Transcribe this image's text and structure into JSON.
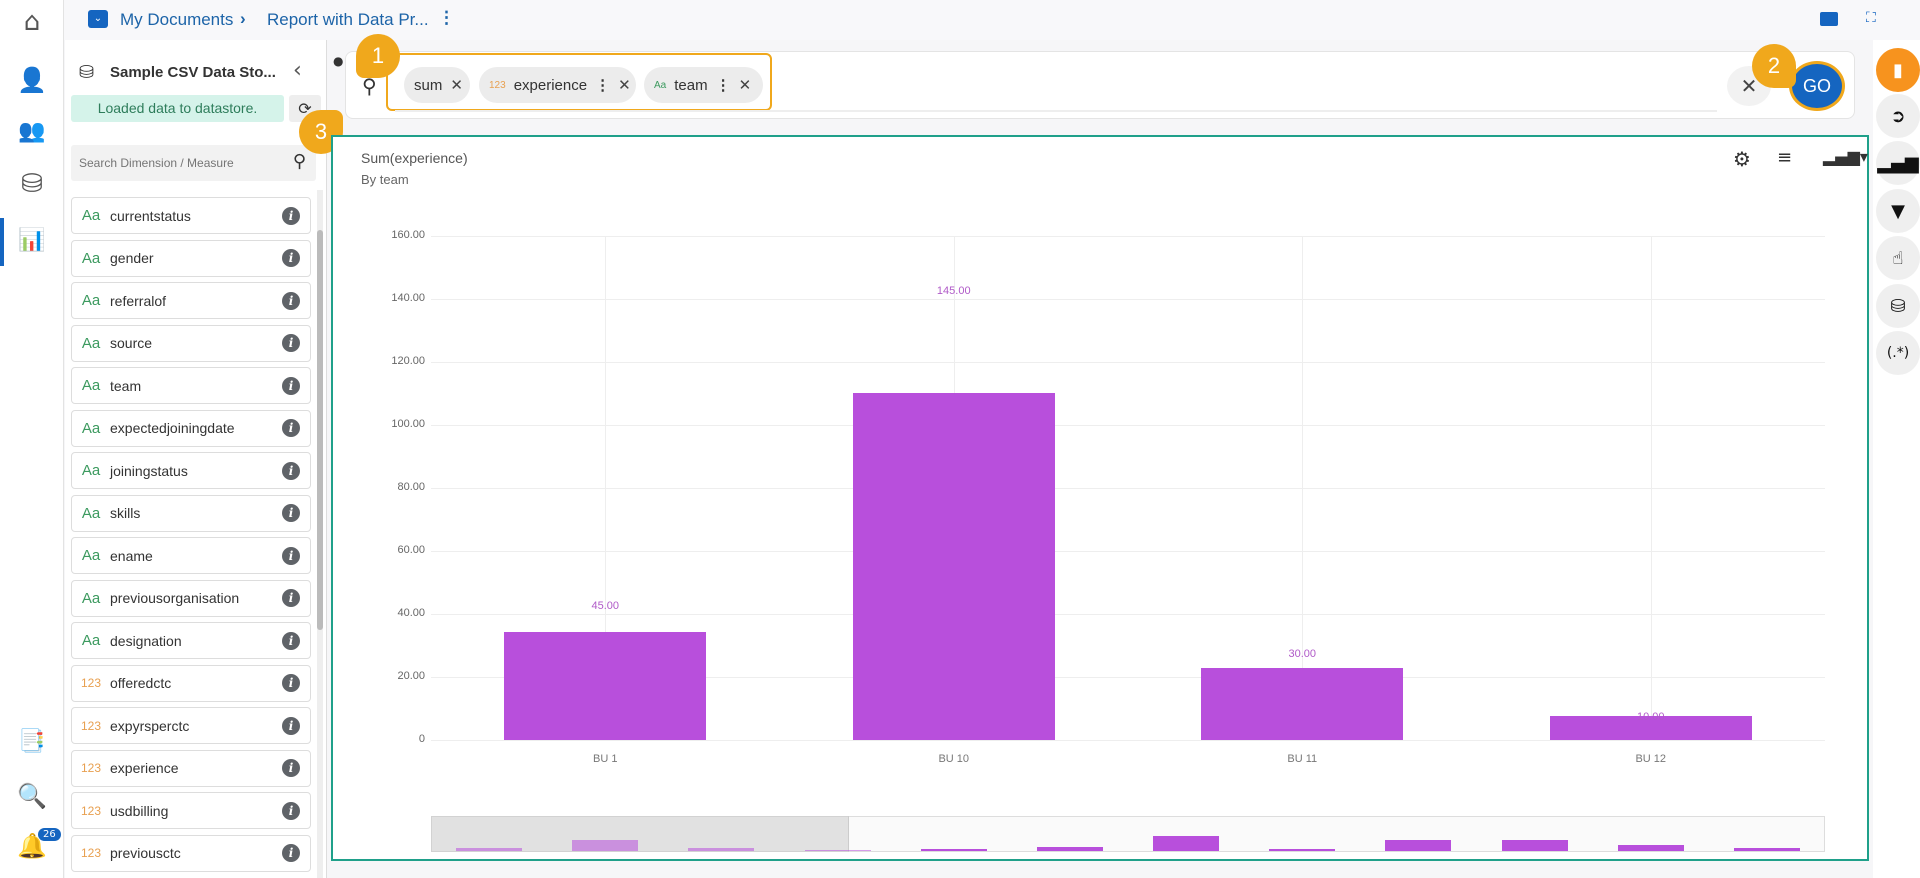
{
  "breadcrumb": {
    "root": "My Documents",
    "current": "Report with Data Pr..."
  },
  "left_nav": {
    "notification_count": "26"
  },
  "panel": {
    "title": "Sample CSV Data Sto...",
    "status": "Loaded data to datastore.",
    "search_placeholder": "Search Dimension / Measure",
    "fields": [
      {
        "type": "Aa",
        "name": "currentstatus"
      },
      {
        "type": "Aa",
        "name": "gender"
      },
      {
        "type": "Aa",
        "name": "referralof"
      },
      {
        "type": "Aa",
        "name": "source"
      },
      {
        "type": "Aa",
        "name": "team"
      },
      {
        "type": "Aa",
        "name": "expectedjoiningdate"
      },
      {
        "type": "Aa",
        "name": "joiningstatus"
      },
      {
        "type": "Aa",
        "name": "skills"
      },
      {
        "type": "Aa",
        "name": "ename"
      },
      {
        "type": "Aa",
        "name": "previousorganisation"
      },
      {
        "type": "Aa",
        "name": "designation"
      },
      {
        "type": "123",
        "name": "offeredctc"
      },
      {
        "type": "123",
        "name": "expyrsperctc"
      },
      {
        "type": "123",
        "name": "experience"
      },
      {
        "type": "123",
        "name": "usdbilling"
      },
      {
        "type": "123",
        "name": "previousctc"
      }
    ]
  },
  "query": {
    "chips": [
      {
        "type": "",
        "label": "sum"
      },
      {
        "type": "123",
        "label": "experience"
      },
      {
        "type": "Aa",
        "label": "team"
      }
    ],
    "go_label": "GO"
  },
  "callouts": [
    "1",
    "2",
    "3"
  ],
  "right_toolbar": {
    "regex_label": "(.*)"
  },
  "colors": {
    "accent": "#1565c0",
    "bar": "#b84fdc",
    "callout": "#f0a81c",
    "panel_border": "#1fa08a"
  },
  "chart_data": {
    "type": "bar",
    "title": "Sum(experience)",
    "subtitle": "By team",
    "categories": [
      "BU 1",
      "BU 10",
      "BU 11",
      "BU 12"
    ],
    "values": [
      45,
      145,
      30,
      10
    ],
    "data_labels": [
      "45.00",
      "145.00",
      "30.00",
      "10.00"
    ],
    "ylim": [
      0,
      160
    ],
    "yticks": [
      "0",
      "20.00",
      "40.00",
      "60.00",
      "80.00",
      "100.00",
      "120.00",
      "140.00",
      "160.00"
    ],
    "grid": true,
    "animation_progress": 0.76,
    "navigator_values": [
      3,
      11,
      3,
      1,
      2,
      4,
      15,
      2,
      11,
      11,
      6,
      3
    ],
    "navigator_selected_fraction": 0.3
  }
}
